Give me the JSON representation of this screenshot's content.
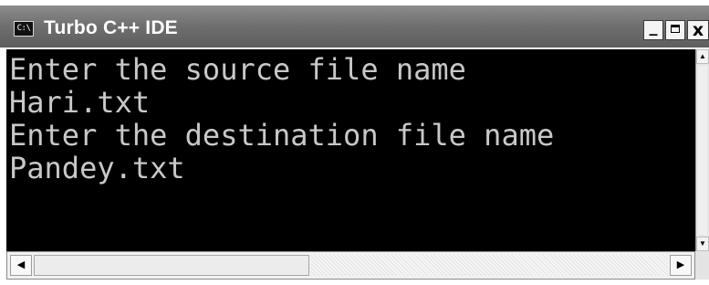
{
  "window": {
    "icon_text": "C:\\",
    "title": "Turbo C++ IDE",
    "buttons": {
      "minimize": "_",
      "close": "x"
    }
  },
  "console": {
    "lines": [
      "Enter the source file name",
      "Hari.txt",
      "Enter the destination file name",
      "Pandey.txt"
    ],
    "background": "#000000",
    "foreground": "#c8c8c8"
  },
  "scrollbars": {
    "up_arrow": "▲",
    "down_arrow": "▼",
    "left_arrow": "◀",
    "right_arrow": "▶"
  }
}
